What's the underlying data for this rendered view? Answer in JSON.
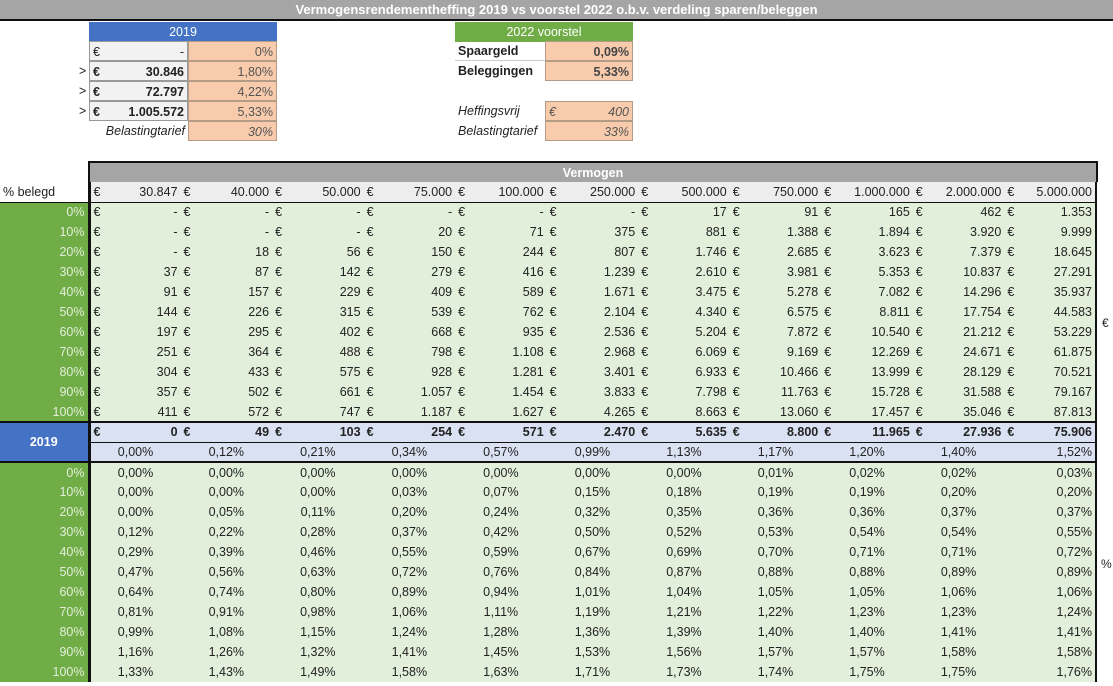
{
  "title": "Vermogensrendementheffing 2019 vs voorstel 2022 o.b.v. verdeling sparen/beleggen",
  "box2019": {
    "header": "2019",
    "rows": [
      {
        "prefix": "",
        "eur": "€",
        "amount": "-",
        "rate": "0%"
      },
      {
        "prefix": ">",
        "eur": "€",
        "amount": "30.846",
        "rate": "1,80%"
      },
      {
        "prefix": ">",
        "eur": "€",
        "amount": "72.797",
        "rate": "4,22%"
      },
      {
        "prefix": ">",
        "eur": "€",
        "amount": "1.005.572",
        "rate": "5,33%"
      }
    ],
    "tarief_label": "Belastingtarief",
    "tarief_value": "30%"
  },
  "box2022": {
    "header": "2022 voorstel",
    "spaargeld_label": "Spaargeld",
    "spaargeld_value": "0,09%",
    "beleggingen_label": "Beleggingen",
    "beleggingen_value": "5,33%",
    "heffingsvrij_label": "Heffingsvrij",
    "heffingsvrij_eur": "€",
    "heffingsvrij_value": "400",
    "tarief_label": "Belastingtarief",
    "tarief_value": "33%"
  },
  "main": {
    "vermogen_label": "Vermogen",
    "belegd_label": "% belegd",
    "currency": "€",
    "side_eur": "€",
    "side_pct": "%",
    "columns": [
      "30.847",
      "40.000",
      "50.000",
      "75.000",
      "100.000",
      "250.000",
      "500.000",
      "750.000",
      "1.000.000",
      "2.000.000",
      "5.000.000"
    ],
    "rows": [
      {
        "pct": "0%",
        "values": [
          "-",
          "-",
          "-",
          "-",
          "-",
          "-",
          "17",
          "91",
          "165",
          "462",
          "1.353"
        ]
      },
      {
        "pct": "10%",
        "values": [
          "-",
          "-",
          "-",
          "20",
          "71",
          "375",
          "881",
          "1.388",
          "1.894",
          "3.920",
          "9.999"
        ]
      },
      {
        "pct": "20%",
        "values": [
          "-",
          "18",
          "56",
          "150",
          "244",
          "807",
          "1.746",
          "2.685",
          "3.623",
          "7.379",
          "18.645"
        ]
      },
      {
        "pct": "30%",
        "values": [
          "37",
          "87",
          "142",
          "279",
          "416",
          "1.239",
          "2.610",
          "3.981",
          "5.353",
          "10.837",
          "27.291"
        ]
      },
      {
        "pct": "40%",
        "values": [
          "91",
          "157",
          "229",
          "409",
          "589",
          "1.671",
          "3.475",
          "5.278",
          "7.082",
          "14.296",
          "35.937"
        ]
      },
      {
        "pct": "50%",
        "values": [
          "144",
          "226",
          "315",
          "539",
          "762",
          "2.104",
          "4.340",
          "6.575",
          "8.811",
          "17.754",
          "44.583"
        ]
      },
      {
        "pct": "60%",
        "values": [
          "197",
          "295",
          "402",
          "668",
          "935",
          "2.536",
          "5.204",
          "7.872",
          "10.540",
          "21.212",
          "53.229"
        ]
      },
      {
        "pct": "70%",
        "values": [
          "251",
          "364",
          "488",
          "798",
          "1.108",
          "2.968",
          "6.069",
          "9.169",
          "12.269",
          "24.671",
          "61.875"
        ]
      },
      {
        "pct": "80%",
        "values": [
          "304",
          "433",
          "575",
          "928",
          "1.281",
          "3.401",
          "6.933",
          "10.466",
          "13.999",
          "28.129",
          "70.521"
        ]
      },
      {
        "pct": "90%",
        "values": [
          "357",
          "502",
          "661",
          "1.057",
          "1.454",
          "3.833",
          "7.798",
          "11.763",
          "15.728",
          "31.588",
          "79.167"
        ]
      },
      {
        "pct": "100%",
        "values": [
          "411",
          "572",
          "747",
          "1.187",
          "1.627",
          "4.265",
          "8.663",
          "13.060",
          "17.457",
          "35.046",
          "87.813"
        ]
      }
    ],
    "row2019": {
      "label": "2019",
      "values": [
        "0",
        "49",
        "103",
        "254",
        "571",
        "2.470",
        "5.635",
        "8.800",
        "11.965",
        "27.936",
        "75.906"
      ],
      "pcts": [
        "0,00%",
        "0,12%",
        "0,21%",
        "0,34%",
        "0,57%",
        "0,99%",
        "1,13%",
        "1,17%",
        "1,20%",
        "1,40%",
        "1,52%"
      ]
    },
    "pct_rows": [
      {
        "pct": "0%",
        "values": [
          "0,00%",
          "0,00%",
          "0,00%",
          "0,00%",
          "0,00%",
          "0,00%",
          "0,00%",
          "0,01%",
          "0,02%",
          "0,02%",
          "0,03%"
        ]
      },
      {
        "pct": "10%",
        "values": [
          "0,00%",
          "0,00%",
          "0,00%",
          "0,03%",
          "0,07%",
          "0,15%",
          "0,18%",
          "0,19%",
          "0,19%",
          "0,20%",
          "0,20%"
        ]
      },
      {
        "pct": "20%",
        "values": [
          "0,00%",
          "0,05%",
          "0,11%",
          "0,20%",
          "0,24%",
          "0,32%",
          "0,35%",
          "0,36%",
          "0,36%",
          "0,37%",
          "0,37%"
        ]
      },
      {
        "pct": "30%",
        "values": [
          "0,12%",
          "0,22%",
          "0,28%",
          "0,37%",
          "0,42%",
          "0,50%",
          "0,52%",
          "0,53%",
          "0,54%",
          "0,54%",
          "0,55%"
        ]
      },
      {
        "pct": "40%",
        "values": [
          "0,29%",
          "0,39%",
          "0,46%",
          "0,55%",
          "0,59%",
          "0,67%",
          "0,69%",
          "0,70%",
          "0,71%",
          "0,71%",
          "0,72%"
        ]
      },
      {
        "pct": "50%",
        "values": [
          "0,47%",
          "0,56%",
          "0,63%",
          "0,72%",
          "0,76%",
          "0,84%",
          "0,87%",
          "0,88%",
          "0,88%",
          "0,89%",
          "0,89%"
        ]
      },
      {
        "pct": "60%",
        "values": [
          "0,64%",
          "0,74%",
          "0,80%",
          "0,89%",
          "0,94%",
          "1,01%",
          "1,04%",
          "1,05%",
          "1,05%",
          "1,06%",
          "1,06%"
        ]
      },
      {
        "pct": "70%",
        "values": [
          "0,81%",
          "0,91%",
          "0,98%",
          "1,06%",
          "1,11%",
          "1,19%",
          "1,21%",
          "1,22%",
          "1,23%",
          "1,23%",
          "1,24%"
        ]
      },
      {
        "pct": "80%",
        "values": [
          "0,99%",
          "1,08%",
          "1,15%",
          "1,24%",
          "1,28%",
          "1,36%",
          "1,39%",
          "1,40%",
          "1,40%",
          "1,41%",
          "1,41%"
        ]
      },
      {
        "pct": "90%",
        "values": [
          "1,16%",
          "1,26%",
          "1,32%",
          "1,41%",
          "1,45%",
          "1,53%",
          "1,56%",
          "1,57%",
          "1,57%",
          "1,58%",
          "1,58%"
        ]
      },
      {
        "pct": "100%",
        "values": [
          "1,33%",
          "1,43%",
          "1,49%",
          "1,58%",
          "1,63%",
          "1,71%",
          "1,73%",
          "1,74%",
          "1,75%",
          "1,75%",
          "1,76%"
        ]
      }
    ]
  }
}
